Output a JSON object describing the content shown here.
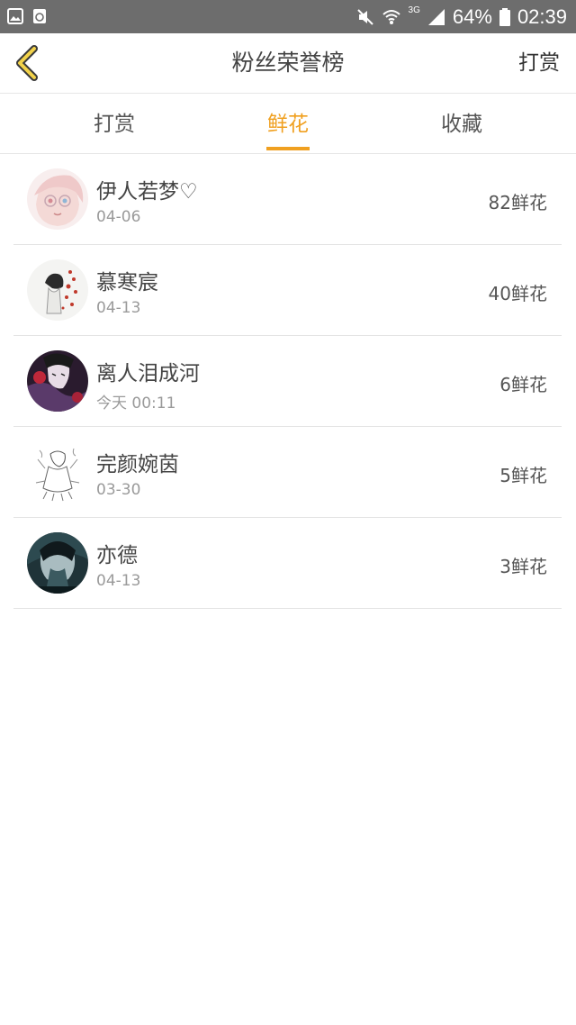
{
  "status_bar": {
    "battery": "64%",
    "time": "02:39",
    "network": "3G",
    "icons": [
      "image-icon",
      "recycle-icon",
      "mute-icon",
      "wifi-icon",
      "signal-icon",
      "battery-icon"
    ]
  },
  "header": {
    "title": "粉丝荣誉榜",
    "right_action": "打赏",
    "back_icon": "chevron-left-icon",
    "accent_color": "#f0a020"
  },
  "tabs": [
    {
      "label": "打赏",
      "active": false
    },
    {
      "label": "鲜花",
      "active": true
    },
    {
      "label": "收藏",
      "active": false
    }
  ],
  "fans": [
    {
      "name": "伊人若梦♡",
      "time": "04-06",
      "flowers": "82鲜花"
    },
    {
      "name": "慕寒宸",
      "time": "04-13",
      "flowers": "40鲜花"
    },
    {
      "name": "离人泪成河",
      "time": "今天 00:11",
      "flowers": "6鲜花"
    },
    {
      "name": "完颜婉茵",
      "time": "03-30",
      "flowers": "5鲜花"
    },
    {
      "name": "亦德",
      "time": "04-13",
      "flowers": "3鲜花"
    }
  ]
}
